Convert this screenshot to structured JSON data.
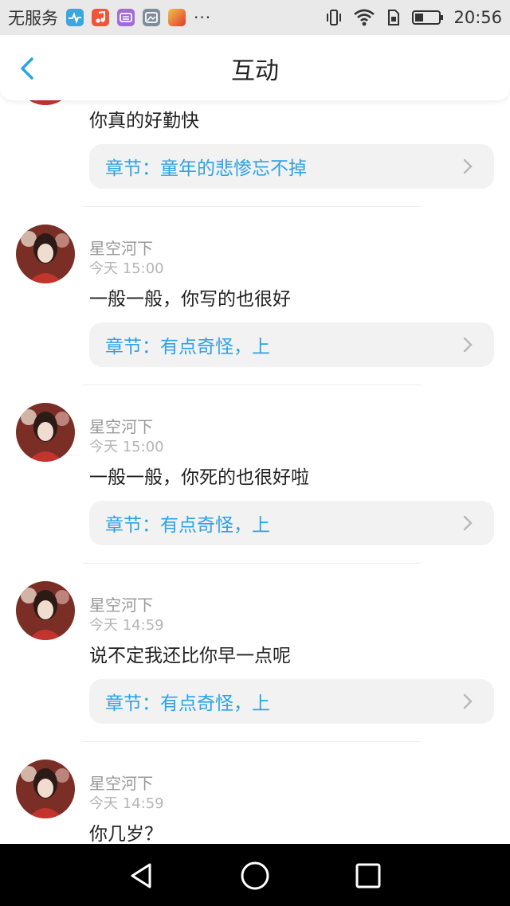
{
  "status_bar": {
    "carrier": "无服务",
    "more": "···",
    "time": "20:56"
  },
  "header": {
    "title": "互动"
  },
  "comments": [
    {
      "name": "",
      "time": "",
      "message": "你真的好勤快",
      "chapter": "章节：童年的悲惨忘不掉"
    },
    {
      "name": "星空河下",
      "time": "今天 15:00",
      "message": "一般一般，你写的也很好",
      "chapter": "章节：有点奇怪，上"
    },
    {
      "name": "星空河下",
      "time": "今天 15:00",
      "message": "一般一般，你死的也很好啦",
      "chapter": "章节：有点奇怪，上"
    },
    {
      "name": "星空河下",
      "time": "今天 14:59",
      "message": "说不定我还比你早一点呢",
      "chapter": "章节：有点奇怪，上"
    },
    {
      "name": "星空河下",
      "time": "今天 14:59",
      "message": "你几岁？",
      "chapter": ""
    }
  ],
  "colors": {
    "accent": "#2ba3e6",
    "status_bar_bg": "#e9e9e9",
    "chapter_bg": "#f2f2f2",
    "nav_bar_bg": "#000000"
  }
}
